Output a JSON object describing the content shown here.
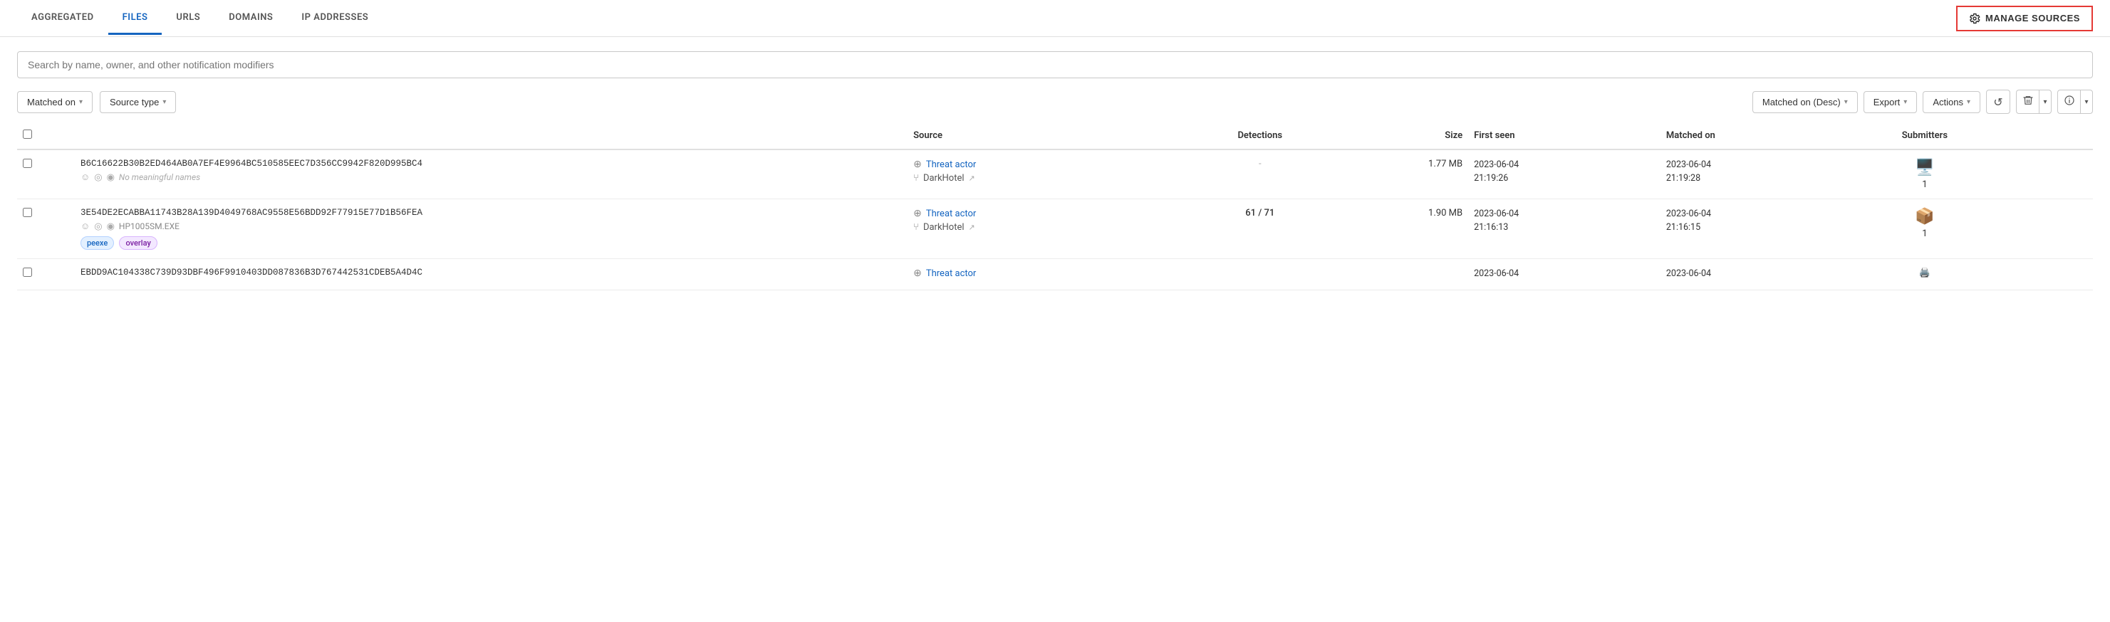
{
  "tabs": [
    {
      "id": "aggregated",
      "label": "AGGREGATED",
      "active": false
    },
    {
      "id": "files",
      "label": "FILES",
      "active": true
    },
    {
      "id": "urls",
      "label": "URLS",
      "active": false
    },
    {
      "id": "domains",
      "label": "DOMAINS",
      "active": false
    },
    {
      "id": "ip_addresses",
      "label": "IP ADDRESSES",
      "active": false
    }
  ],
  "manage_sources": "MANAGE SOURCES",
  "search_placeholder": "Search by name, owner, and other notification modifiers",
  "filters": {
    "matched_on": "Matched on",
    "source_type": "Source type"
  },
  "toolbar": {
    "sort_label": "Matched on (Desc)",
    "export_label": "Export",
    "actions_label": "Actions",
    "refresh_icon": "↺",
    "delete_icon": "🗑",
    "info_icon": "ℹ"
  },
  "table": {
    "columns": [
      "",
      "",
      "Source",
      "Detections",
      "Size",
      "First seen",
      "Matched on",
      "Submitters",
      ""
    ],
    "rows": [
      {
        "hash": "B6C16622B30B2ED464AB0A7EF4E9964BC510585EEC7D356CC9942F820D995BC4",
        "names": [
          "No meaningful names"
        ],
        "tags": [],
        "source_type": "Threat actor",
        "source_name": "DarkHotel",
        "detections": "-",
        "size": "1.77 MB",
        "first_seen_date": "2023-06-04",
        "first_seen_time": "21:19:26",
        "matched_on_date": "2023-06-04",
        "matched_on_time": "21:19:28",
        "submitters": "1",
        "submitter_icon": "🖥"
      },
      {
        "hash": "3E54DE2ECABBA11743B28A139D4049768AC9558E56BDD92F77915E77D1B56FEA",
        "names": [
          "HP1005SM.EXE"
        ],
        "tags": [
          "peexe",
          "overlay"
        ],
        "source_type": "Threat actor",
        "source_name": "DarkHotel",
        "detections": "61 / 71",
        "size": "1.90 MB",
        "first_seen_date": "2023-06-04",
        "first_seen_time": "21:16:13",
        "matched_on_date": "2023-06-04",
        "matched_on_time": "21:16:15",
        "submitters": "1",
        "submitter_icon": "📦"
      },
      {
        "hash": "EBDD9AC104338C739D93DBF496F9910403DD087836B3D767442531CDEB5A4D4C",
        "names": [],
        "tags": [],
        "source_type": "Threat actor",
        "source_name": "",
        "detections": "",
        "size": "",
        "first_seen_date": "2023-06-04",
        "first_seen_time": "",
        "matched_on_date": "2023-06-04",
        "matched_on_time": "",
        "submitters": "",
        "submitter_icon": "🖨"
      }
    ]
  }
}
